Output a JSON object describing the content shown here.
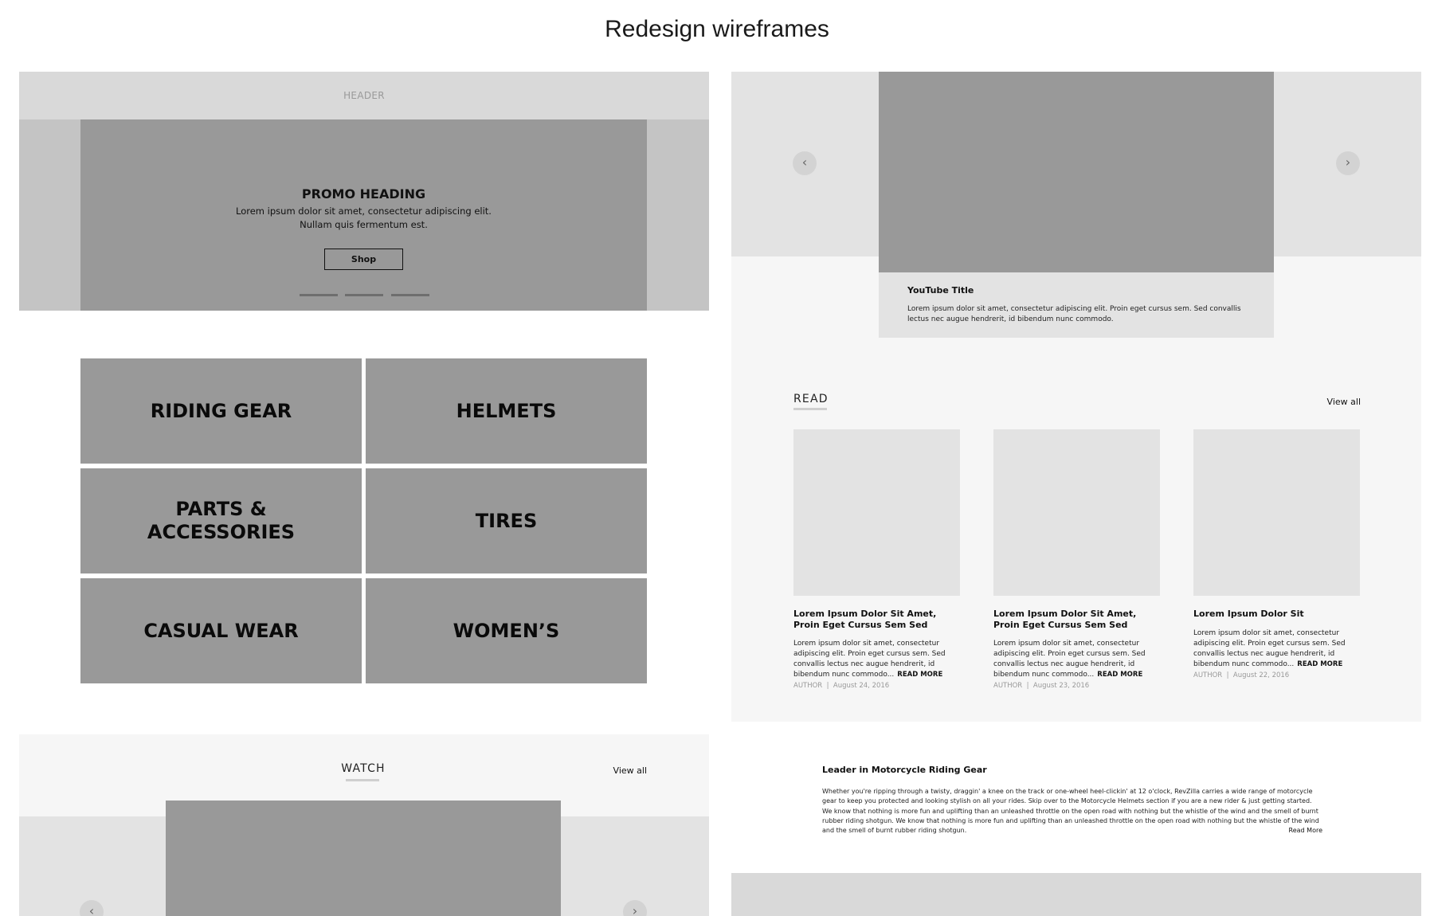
{
  "page_title": "Redesign wireframes",
  "header": {
    "label": "HEADER"
  },
  "hero": {
    "heading": "PROMO HEADING",
    "text_line1": "Lorem ipsum dolor sit amet, consectetur adipiscing elit.",
    "text_line2": "Nullam quis fermentum est.",
    "button_label": "Shop",
    "slide_count": 3
  },
  "categories": [
    {
      "line1": "RIDING GEAR",
      "line2": ""
    },
    {
      "line1": "HELMETS",
      "line2": ""
    },
    {
      "line1": "PARTS &",
      "line2": "ACCESSORIES"
    },
    {
      "line1": "TIRES",
      "line2": ""
    },
    {
      "line1": "CASUAL WEAR",
      "line2": ""
    },
    {
      "line1": "WOMEN’S",
      "line2": ""
    }
  ],
  "watch": {
    "title": "WATCH",
    "view_all": "View all",
    "prev_arrow": "‹",
    "next_arrow": "›"
  },
  "video": {
    "prev_arrow": "‹",
    "next_arrow": "›",
    "title": "YouTube Title",
    "description": "Lorem ipsum dolor sit amet, consectetur adipiscing elit. Proin eget cursus sem. Sed convallis lectus nec augue hendrerit, id bibendum nunc commodo."
  },
  "read": {
    "title": "READ",
    "view_all": "View all",
    "cards": [
      {
        "title": "Lorem Ipsum Dolor Sit Amet, Proin Eget Cursus Sem Sed",
        "body": "Lorem ipsum dolor sit amet, consectetur adipiscing elit. Proin eget cursus sem. Sed convallis lectus nec augue hendrerit, id bibendum nunc commodo...",
        "read_more": "READ MORE",
        "author": "AUTHOR",
        "separator": "|",
        "date": "August 24, 2016"
      },
      {
        "title": "Lorem Ipsum Dolor Sit Amet, Proin Eget Cursus Sem Sed",
        "body": "Lorem ipsum dolor sit amet, consectetur adipiscing elit. Proin eget cursus sem. Sed convallis lectus nec augue hendrerit, id bibendum nunc commodo...",
        "read_more": "READ MORE",
        "author": "AUTHOR",
        "separator": "|",
        "date": "August 23, 2016"
      },
      {
        "title": "Lorem Ipsum Dolor Sit",
        "body": "Lorem ipsum dolor sit amet, consectetur adipiscing elit. Proin eget cursus sem. Sed convallis lectus nec augue hendrerit, id bibendum nunc commodo...",
        "read_more": "READ MORE",
        "author": "AUTHOR",
        "separator": "|",
        "date": "August 22, 2016"
      }
    ]
  },
  "leader": {
    "heading": "Leader in Motorcycle Riding Gear",
    "paragraph": "Whether you're ripping through a twisty, draggin' a knee on the track or one-wheel heel-clickin' at 12 o'clock, RevZilla carries a wide range of motorcycle gear to keep you protected and looking stylish on all your rides. Skip over to the Motorcycle Helmets section if you are a new rider & just getting started. We know that nothing is more fun and uplifting than an unleashed throttle on the open road with nothing but the whistle of the wind and the smell of burnt rubber riding shotgun. We know that nothing is more fun and uplifting than an unleashed throttle on the open road with nothing but the whistle of the wind and the smell of burnt rubber riding shotgun.",
    "read_more": "Read More"
  },
  "colors": {
    "placeholder_dark": "#999999",
    "placeholder_light": "#e3e3e3",
    "header_gray": "#d9d9d9",
    "section_bg": "#f6f6f6"
  }
}
